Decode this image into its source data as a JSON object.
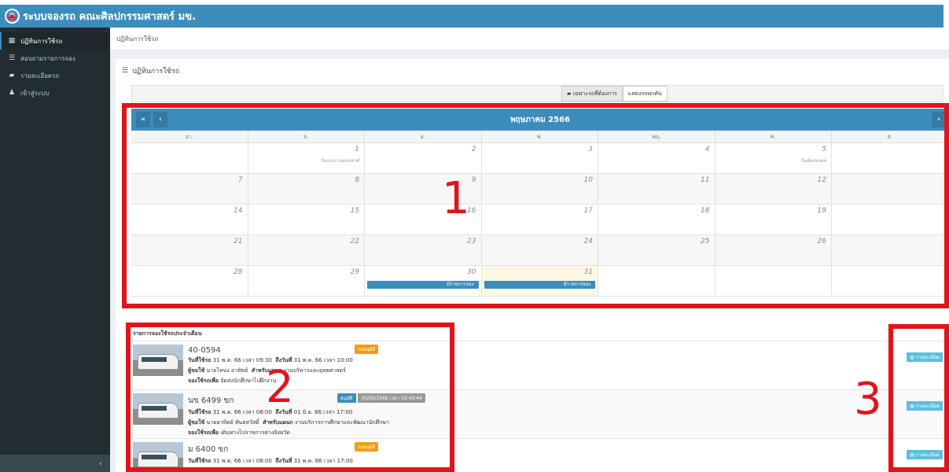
{
  "app": {
    "title": "ระบบจองรถ คณะศิลปกรรมศาสตร์ มข.",
    "logo_icon": "car-icon"
  },
  "sidebar": {
    "items": [
      {
        "label": "ปฏิทินการใช้รถ",
        "icon": "calendar-icon",
        "active": true
      },
      {
        "label": "สอบถามรายการจอง",
        "icon": "list-icon",
        "active": false
      },
      {
        "label": "รายละเอียดรถ",
        "icon": "car-icon",
        "active": false
      },
      {
        "label": "เข้าสู่ระบบ",
        "icon": "user-icon",
        "active": false
      }
    ],
    "collapse_label": "‹"
  },
  "breadcrumb": "ปฏิทินการใช้รถ",
  "box_title": "ปฏิทินการใช้รถ",
  "filter": {
    "only_label": "เฉพาะรถที่ต้องการ",
    "all_label": "แสดงรถทุกคัน"
  },
  "calendar": {
    "month_title": "พฤษภาคม 2566",
    "weekdays": [
      "อา.",
      "จ.",
      "อ.",
      "พ.",
      "พฤ.",
      "ศ.",
      "ส."
    ],
    "weeks": [
      [
        {
          "d": ""
        },
        {
          "d": "1",
          "note": "วันแรงงานแห่งชาติ"
        },
        {
          "d": "2"
        },
        {
          "d": "3"
        },
        {
          "d": "4"
        },
        {
          "d": "5",
          "note": "วันฉัตรมงคล"
        },
        {
          "d": ""
        }
      ],
      [
        {
          "d": "7"
        },
        {
          "d": "8"
        },
        {
          "d": "9"
        },
        {
          "d": "10"
        },
        {
          "d": "11"
        },
        {
          "d": "12"
        },
        {
          "d": ""
        }
      ],
      [
        {
          "d": "14"
        },
        {
          "d": "15"
        },
        {
          "d": "16"
        },
        {
          "d": "17"
        },
        {
          "d": "18"
        },
        {
          "d": "19"
        },
        {
          "d": ""
        }
      ],
      [
        {
          "d": "21"
        },
        {
          "d": "22"
        },
        {
          "d": "23"
        },
        {
          "d": "24"
        },
        {
          "d": "25"
        },
        {
          "d": "26"
        },
        {
          "d": ""
        }
      ],
      [
        {
          "d": "28"
        },
        {
          "d": "29"
        },
        {
          "d": "30",
          "event": "มีรายการจอง"
        },
        {
          "d": "31",
          "event": "มีรายการจอง",
          "today": true
        },
        {
          "d": ""
        },
        {
          "d": ""
        },
        {
          "d": ""
        }
      ]
    ]
  },
  "bookings": {
    "title": "รายการจองใช้รถประจำเดือน",
    "items": [
      {
        "plate": "40-0594",
        "status": "รออนุมัติ",
        "status_color": "#f39c12",
        "use_label": "วันที่ใช้รถ",
        "use_value": "31 พ.ค. 66 เวลา 09:30",
        "to_label": "ถึงวันที่",
        "to_value": "31 พ.ค. 66 เวลา 10:00",
        "user_label": "ผู้ขอใช้",
        "user_value": "นายไหน่ง อาทิตย์",
        "dept_label": "สำหรับแผนก",
        "dept_value": "งานบริหารและยุทธศาสตร์",
        "purpose_label": "จองใช้รถเพื่อ",
        "purpose_value": "จัดส่งนักศึกษาไปฝึกงาน",
        "detail_label": "รายละเอียด"
      },
      {
        "plate": "นข 6499 ขก",
        "status": "อนุมัติ",
        "status_time": "30/05/2566 เวลา 10:40:44",
        "status_color": "#3c8dbc",
        "use_label": "วันที่ใช้รถ",
        "use_value": "31 พ.ค. 66 เวลา 08:00",
        "to_label": "ถึงวันที่",
        "to_value": "01 มิ.ย. 66 เวลา 17:00",
        "user_label": "ผู้ขอใช้",
        "user_value": "นายอาทิตย์ ทันธสวัสดิ์",
        "dept_label": "สำหรับแผนก",
        "dept_value": "งานบริการการศึกษาและพัฒนานักศึกษา",
        "purpose_label": "จองใช้รถเพื่อ",
        "purpose_value": "เดินทางไปราชการต่างจังหวัด",
        "detail_label": "รายละเอียด"
      },
      {
        "plate": "ม 6400 ขก",
        "status": "รออนุมัติ",
        "status_color": "#f39c12",
        "use_label": "วันที่ใช้รถ",
        "use_value": "31 พ.ค. 66 เวลา 08:00",
        "to_label": "ถึงวันที่",
        "to_value": "31 พ.ค. 66 เวลา 17:00",
        "detail_label": "รายละเอียด"
      }
    ]
  },
  "annotations": [
    {
      "label": "1",
      "color": "#e3131b"
    },
    {
      "label": "2",
      "color": "#e3131b"
    },
    {
      "label": "3",
      "color": "#e3131b"
    }
  ]
}
